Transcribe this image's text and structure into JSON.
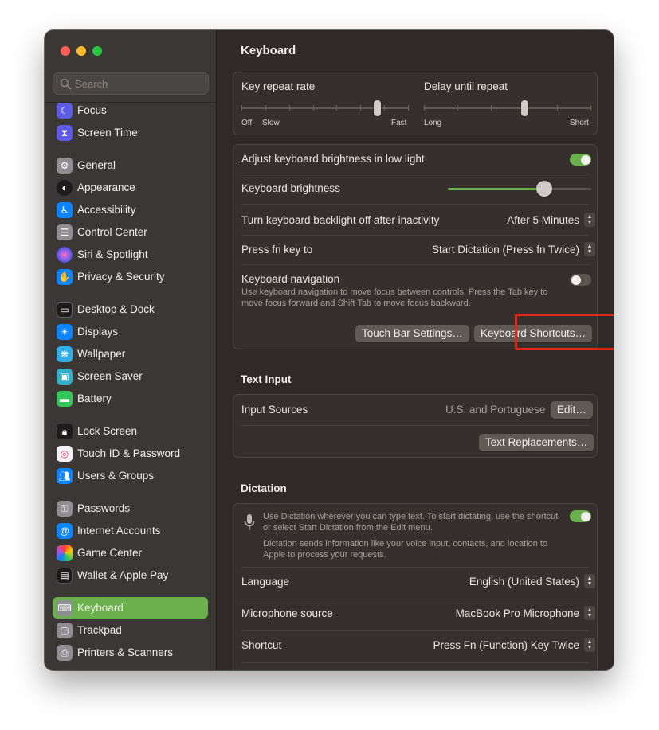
{
  "window": {
    "title": "Keyboard"
  },
  "search": {
    "placeholder": "Search"
  },
  "sidebar": {
    "items": [
      {
        "label": "Focus",
        "icon": "moon-icon",
        "color": "#5e5ce6"
      },
      {
        "label": "Screen Time",
        "icon": "hourglass-icon",
        "color": "#5e5ce6"
      },
      {
        "label": "General",
        "icon": "gear-icon",
        "color": "#8e8e93"
      },
      {
        "label": "Appearance",
        "icon": "appearance-icon",
        "color": "#1c1c1e"
      },
      {
        "label": "Accessibility",
        "icon": "accessibility-icon",
        "color": "#0a84ff"
      },
      {
        "label": "Control Center",
        "icon": "control-center-icon",
        "color": "#8e8e93"
      },
      {
        "label": "Siri & Spotlight",
        "icon": "siri-icon",
        "color": "#bf5af2"
      },
      {
        "label": "Privacy & Security",
        "icon": "hand-icon",
        "color": "#0a84ff"
      },
      {
        "label": "Desktop & Dock",
        "icon": "dock-icon",
        "color": "#1c1c1e"
      },
      {
        "label": "Displays",
        "icon": "sun-icon",
        "color": "#0a84ff"
      },
      {
        "label": "Wallpaper",
        "icon": "wallpaper-icon",
        "color": "#32ade6"
      },
      {
        "label": "Screen Saver",
        "icon": "screen-saver-icon",
        "color": "#30b0c7"
      },
      {
        "label": "Battery",
        "icon": "battery-icon",
        "color": "#34c759"
      },
      {
        "label": "Lock Screen",
        "icon": "lock-icon",
        "color": "#1c1c1e"
      },
      {
        "label": "Touch ID & Password",
        "icon": "fingerprint-icon",
        "color": "#f2f2f7"
      },
      {
        "label": "Users & Groups",
        "icon": "users-icon",
        "color": "#0a84ff"
      },
      {
        "label": "Passwords",
        "icon": "key-icon",
        "color": "#8e8e93"
      },
      {
        "label": "Internet Accounts",
        "icon": "at-icon",
        "color": "#0a84ff"
      },
      {
        "label": "Game Center",
        "icon": "game-center-icon",
        "color": "#f2f2f7"
      },
      {
        "label": "Wallet & Apple Pay",
        "icon": "wallet-icon",
        "color": "#1c1c1e"
      },
      {
        "label": "Keyboard",
        "icon": "keyboard-icon",
        "color": "#8e8e93",
        "selected": true
      },
      {
        "label": "Trackpad",
        "icon": "trackpad-icon",
        "color": "#8e8e93"
      },
      {
        "label": "Printers & Scanners",
        "icon": "printer-icon",
        "color": "#8e8e93"
      }
    ]
  },
  "repeat": {
    "rate_label": "Key repeat rate",
    "rate_off": "Off",
    "rate_slow": "Slow",
    "rate_fast": "Fast",
    "rate_level": 0.81,
    "delay_label": "Delay until repeat",
    "delay_long": "Long",
    "delay_short": "Short",
    "delay_level": 0.6
  },
  "brightness": {
    "adjust_label": "Adjust keyboard brightness in low light",
    "adjust_on": true,
    "kb_label": "Keyboard brightness",
    "kb_level": 0.67,
    "backlight_label": "Turn keyboard backlight off after inactivity",
    "backlight_value": "After 5 Minutes",
    "fn_label": "Press fn key to",
    "fn_value": "Start Dictation (Press fn Twice)",
    "nav_label": "Keyboard navigation",
    "nav_on": false,
    "nav_desc": "Use keyboard navigation to move focus between controls. Press the Tab key to move focus forward and Shift Tab to move focus backward.",
    "touchbar_button": "Touch Bar Settings…",
    "shortcuts_button": "Keyboard Shortcuts…"
  },
  "text_input": {
    "section_title": "Text Input",
    "sources_label": "Input Sources",
    "sources_value": "U.S. and Portuguese",
    "edit_button": "Edit…",
    "replacements_button": "Text Replacements…"
  },
  "dictation": {
    "section_title": "Dictation",
    "desc1": "Use Dictation wherever you can type text. To start dictating, use the shortcut or select Start Dictation from the Edit menu.",
    "desc2": "Dictation sends information like your voice input, contacts, and location to Apple to process your requests.",
    "enabled": true,
    "language_label": "Language",
    "language_value": "English (United States)",
    "mic_label": "Microphone source",
    "mic_value": "MacBook Pro Microphone",
    "shortcut_label": "Shortcut",
    "shortcut_value": "Press Fn (Function) Key Twice"
  },
  "colors": {
    "accent": "#6ab04c",
    "highlight": "#e0271a"
  }
}
